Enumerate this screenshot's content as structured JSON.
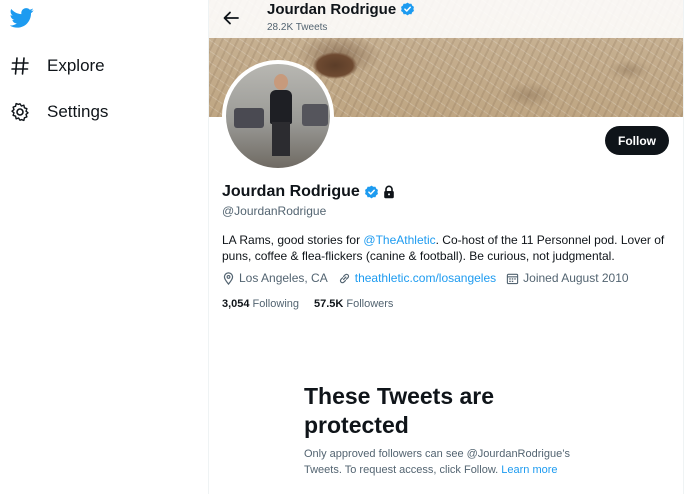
{
  "colors": {
    "accent": "#1d9bf0",
    "text": "#0f1419",
    "muted": "#536471",
    "button_bg": "#0f1419"
  },
  "sidebar": {
    "logo_icon": "twitter-bird-icon",
    "items": [
      {
        "label": "Explore",
        "icon": "hashtag-icon"
      },
      {
        "label": "Settings",
        "icon": "gear-icon"
      }
    ]
  },
  "header": {
    "name": "Jourdan Rodrigue",
    "tweet_count": "28.2K Tweets"
  },
  "profile": {
    "name": "Jourdan Rodrigue",
    "handle": "@JourdanRodrigue",
    "follow_label": "Follow",
    "bio": {
      "pre": "LA Rams, good stories for ",
      "mention": "@TheAthletic",
      "post": ". Co-host of the 11 Personnel pod. Lover of puns, coffee & flea-flickers (canine & football). Be curious, not judgmental."
    },
    "location": "Los Angeles, CA",
    "website": "theathletic.com/losangeles",
    "joined": "Joined August 2010",
    "following_count": "3,054",
    "following_label": "Following",
    "followers_count": "57.5K",
    "followers_label": "Followers"
  },
  "protected": {
    "title": "These Tweets are protected",
    "text": "Only approved followers can see @JourdanRodrigue’s Tweets. To request access, click Follow.",
    "learn_more": "Learn more"
  }
}
